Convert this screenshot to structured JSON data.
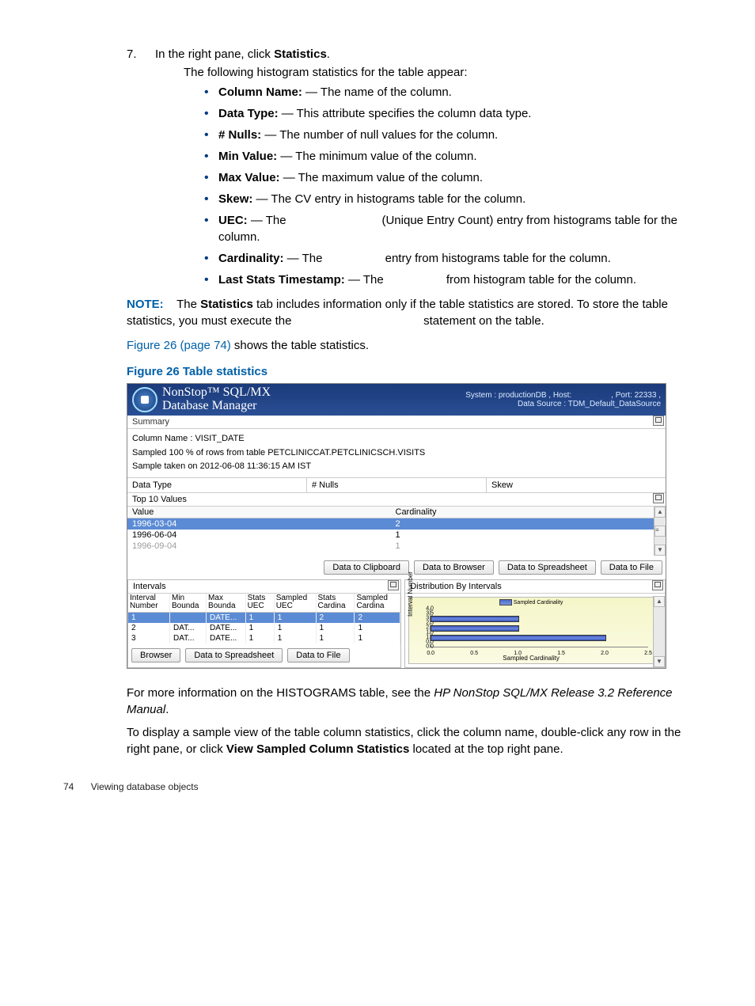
{
  "step": {
    "number": "7.",
    "text_pre": "In the right pane, click ",
    "text_bold": "Statistics",
    "text_post": ".",
    "followup": "The following histogram statistics for the table appear:"
  },
  "bullets": [
    {
      "label": "Column Name:",
      "rest": " — The name of the column."
    },
    {
      "label": "Data Type:",
      "rest": " — This attribute specifies the column data type."
    },
    {
      "label": "# Nulls:",
      "rest": " — The number of null values for the column."
    },
    {
      "label": "Min Value:",
      "rest": " — The minimum value of the column."
    },
    {
      "label": "Max Value:",
      "rest": " — The maximum value of the column."
    },
    {
      "label": "Skew:",
      "rest": " — The CV entry in histograms table for the column."
    },
    {
      "label": "UEC:",
      "rest_pre": " — The ",
      "rest_mid": "(Unique Entry Count) entry from histograms table for the column."
    },
    {
      "label": "Cardinality:",
      "rest_pre": " — The ",
      "rest_mid": "entry from histograms table for the column."
    },
    {
      "label": "Last Stats Timestamp:",
      "rest_pre": " — The ",
      "rest_mid": "from histogram table for the column."
    }
  ],
  "note": {
    "label": "NOTE:",
    "text1": "The ",
    "bold1": "Statistics",
    "text2": " tab includes information only if the table statistics are stored. To store the table statistics, you must execute the ",
    "text3": "statement on the table."
  },
  "figref": {
    "link": "Figure 26 (page 74)",
    "rest": " shows the table statistics."
  },
  "figtitle": "Figure 26 Table statistics",
  "ss": {
    "app_line1": "NonStop™ SQL/MX",
    "app_line2": "Database Manager",
    "hdr_right1_a": "System : productionDB , Host: ",
    "hdr_right1_b": " , Port: 22333 ,",
    "hdr_right2": "Data Source : TDM_Default_DataSource",
    "summary_label": "Summary",
    "col_name": "Column Name : VISIT_DATE",
    "sampled": "Sampled 100 % of rows from table PETCLINICCAT.PETCLINICSCH.VISITS",
    "taken": "Sample taken on 2012-06-08 11:36:15 AM IST",
    "cols_row": {
      "a": "Data Type",
      "b": "# Nulls",
      "c": "Skew"
    },
    "top10_label": "Top 10 Values",
    "top10": {
      "hdr_value": "Value",
      "hdr_card": "Cardinality",
      "rows": [
        {
          "value": "1996-03-04",
          "card": "2"
        },
        {
          "value": "1996-06-04",
          "card": "1"
        },
        {
          "value": "1996-09-04",
          "card": "1"
        }
      ]
    },
    "btns": {
      "clip": "Data to Clipboard",
      "browser": "Data to Browser",
      "spread": "Data to Spreadsheet",
      "file": "Data to File"
    },
    "intervals": {
      "title": "Intervals",
      "hdr": [
        "Interval Number",
        "Min Bounda",
        "Max Bounda",
        "Stats UEC",
        "Sampled UEC",
        "Stats Cardina",
        "Sampled Cardina"
      ],
      "rows": [
        {
          "c": [
            "1",
            "",
            "DATE...",
            "1",
            "1",
            "2",
            "2"
          ]
        },
        {
          "c": [
            "2",
            "DAT...",
            "DATE...",
            "1",
            "1",
            "1",
            "1"
          ]
        },
        {
          "c": [
            "3",
            "DAT...",
            "DATE...",
            "1",
            "1",
            "1",
            "1"
          ]
        }
      ],
      "btns": {
        "browser": "Browser",
        "spread": "Data to Spreadsheet",
        "file": "Data to File"
      }
    },
    "dist": {
      "title": "Distribution By Intervals",
      "legend": "Sampled Cardinality",
      "ylabel": "Interval Number",
      "xlabel": "Sampled Cardinality"
    }
  },
  "chart_data": {
    "type": "bar",
    "orientation": "horizontal",
    "title": "Distribution By Intervals",
    "series": [
      {
        "name": "Sampled Cardinality",
        "values": [
          2.0,
          1.0,
          1.0
        ]
      }
    ],
    "categories": [
      1,
      2,
      3
    ],
    "xlabel": "Sampled Cardinality",
    "ylabel": "Interval Number",
    "xlim": [
      0.0,
      2.5
    ],
    "ylim": [
      0.0,
      4.0
    ],
    "xticks": [
      0.0,
      0.5,
      1.0,
      1.5,
      2.0,
      2.5
    ],
    "yticks": [
      0.0,
      0.5,
      1.0,
      1.5,
      2.0,
      2.5,
      3.0,
      3.5,
      4.0
    ]
  },
  "post": {
    "p1a": "For more information on the HISTOGRAMS table, see the ",
    "p1b": "HP NonStop SQL/MX Release 3.2 Reference Manual",
    "p1c": ".",
    "p2a": "To display a sample view of the table column statistics, click the column name, double-click any row in the right pane, or click ",
    "p2b": "View Sampled Column Statistics",
    "p2c": " located at the top right pane."
  },
  "footer": {
    "page": "74",
    "section": "Viewing database objects"
  }
}
